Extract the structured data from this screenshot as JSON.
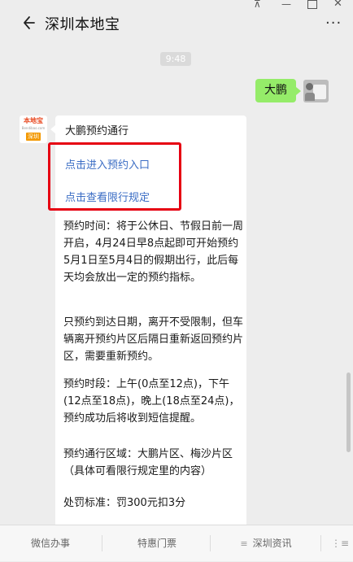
{
  "window": {
    "pin_icon": "pin-icon",
    "min_icon": "minimize-icon",
    "max_icon": "maximize-icon",
    "close_glyph": "✕"
  },
  "header": {
    "title": "深圳本地宝",
    "back_icon": "arrow-left-icon",
    "more_glyph": "···"
  },
  "chat": {
    "timestamp": "9:48",
    "outgoing": {
      "text": "大鹏"
    },
    "sender_avatar": {
      "line1": "本地宝",
      "line2": "Bendibao.com",
      "line3": "深圳"
    },
    "incoming": {
      "title": "大鹏预约通行",
      "link1": "点击进入预约入口",
      "link2": "点击查看限行规定",
      "para1": "预约时间：将于公休日、节假日前一周开启，4月24日早8点起即可开始预约5月1日至5月4日的假期出行，此后每天均会放出一定的预约指标。",
      "para2": "只预约到达日期，离开不受限制，但车辆离开预约片区后隔日重新返回预约片区，需要重新预约。",
      "para3": "预约时段：上午(0点至12点)，下午(12点至18点)，晚上(18点至24点)，预约成功后将收到短信提醒。",
      "para4": "预约通行区域：大鹏片区、梅沙片区（具体可看限行规定里的内容）",
      "para5": "处罚标准：罚300元扣3分"
    }
  },
  "bottom_menu": {
    "item1": "微信办事",
    "item2": "特惠门票",
    "item3": "深圳资讯",
    "item3_icon": "≡",
    "keyboard_glyph": "⋮≡"
  },
  "colors": {
    "background": "#ededed",
    "bubble_out": "#95ec69",
    "link": "#3a6cc4",
    "highlight_box": "#e60012"
  }
}
